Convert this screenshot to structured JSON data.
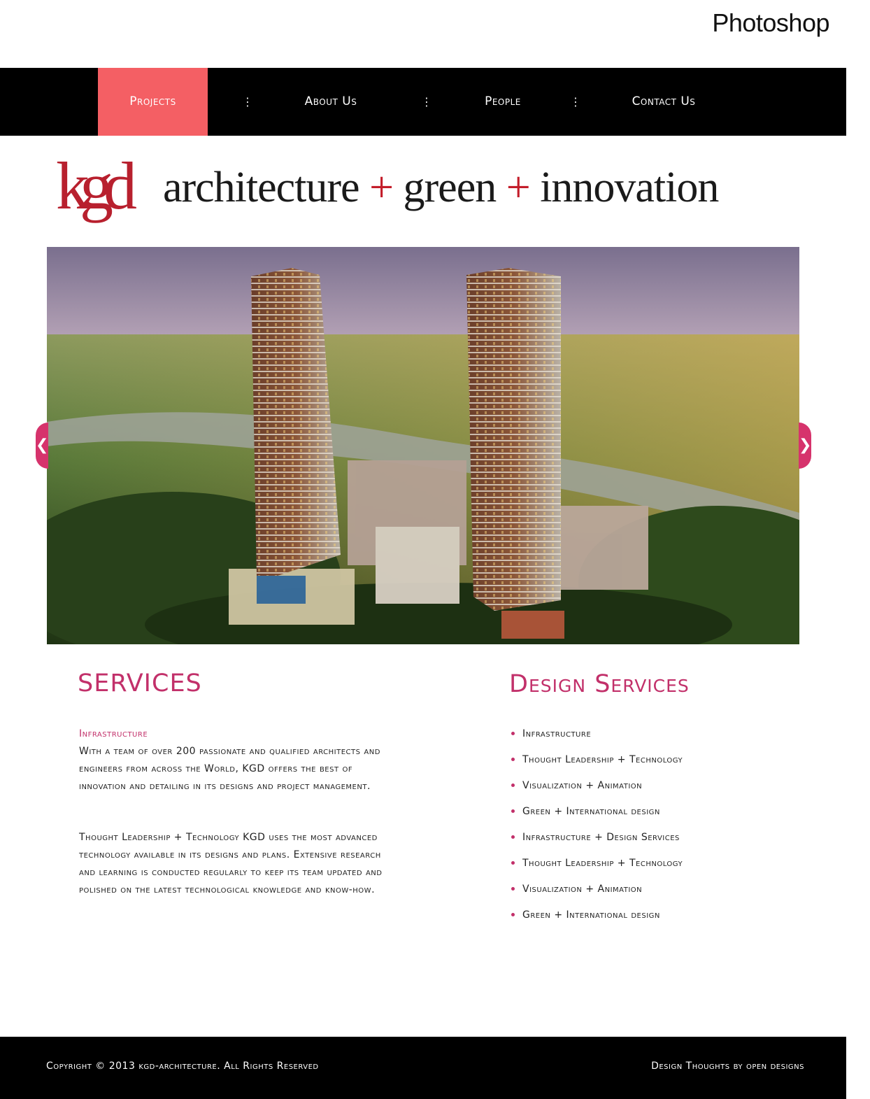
{
  "app": {
    "label": "Photoshop"
  },
  "nav": {
    "items": [
      {
        "label": "Projects"
      },
      {
        "label": "About Us"
      },
      {
        "label": "People"
      },
      {
        "label": "Contact Us"
      }
    ],
    "separator": "⋮",
    "active_color": "#f45f64"
  },
  "logo": {
    "mark": "kgd",
    "tagline_word1": "architecture",
    "plus": "+",
    "tagline_word2": "green",
    "tagline_word3": "innovation",
    "brand_color": "#c31d2a"
  },
  "slider": {
    "prev_label": "❮",
    "next_label": "❯",
    "accent": "#d6336c"
  },
  "services": {
    "title": "SERVICES",
    "subhead": "Infrastructure",
    "para1": "With a team of over 200 passionate and qualified architects and engineers from across the World, KGD offers the best of innovation and detailing in its designs and project management.",
    "para2": "Thought Leadership + Technology KGD uses the most advanced technology available in its designs and plans. Extensive research and learning is conducted regularly to keep its team updated and polished on the latest technological knowledge and know-how."
  },
  "design_services": {
    "title": "Design Services",
    "items": [
      "Infrastructure",
      "Thought Leadership + Technology",
      "Visualization + Animation",
      "Green + International design",
      "Infrastructure + Design Services",
      "Thought Leadership + Technology",
      "Visualization + Animation",
      "Green + International design"
    ]
  },
  "footer": {
    "copyright": "Copyright © 2013 kgd-architecture. All Rights Reserved",
    "credit": "Design Thoughts by open designs"
  },
  "accent_color": "#c2306a"
}
